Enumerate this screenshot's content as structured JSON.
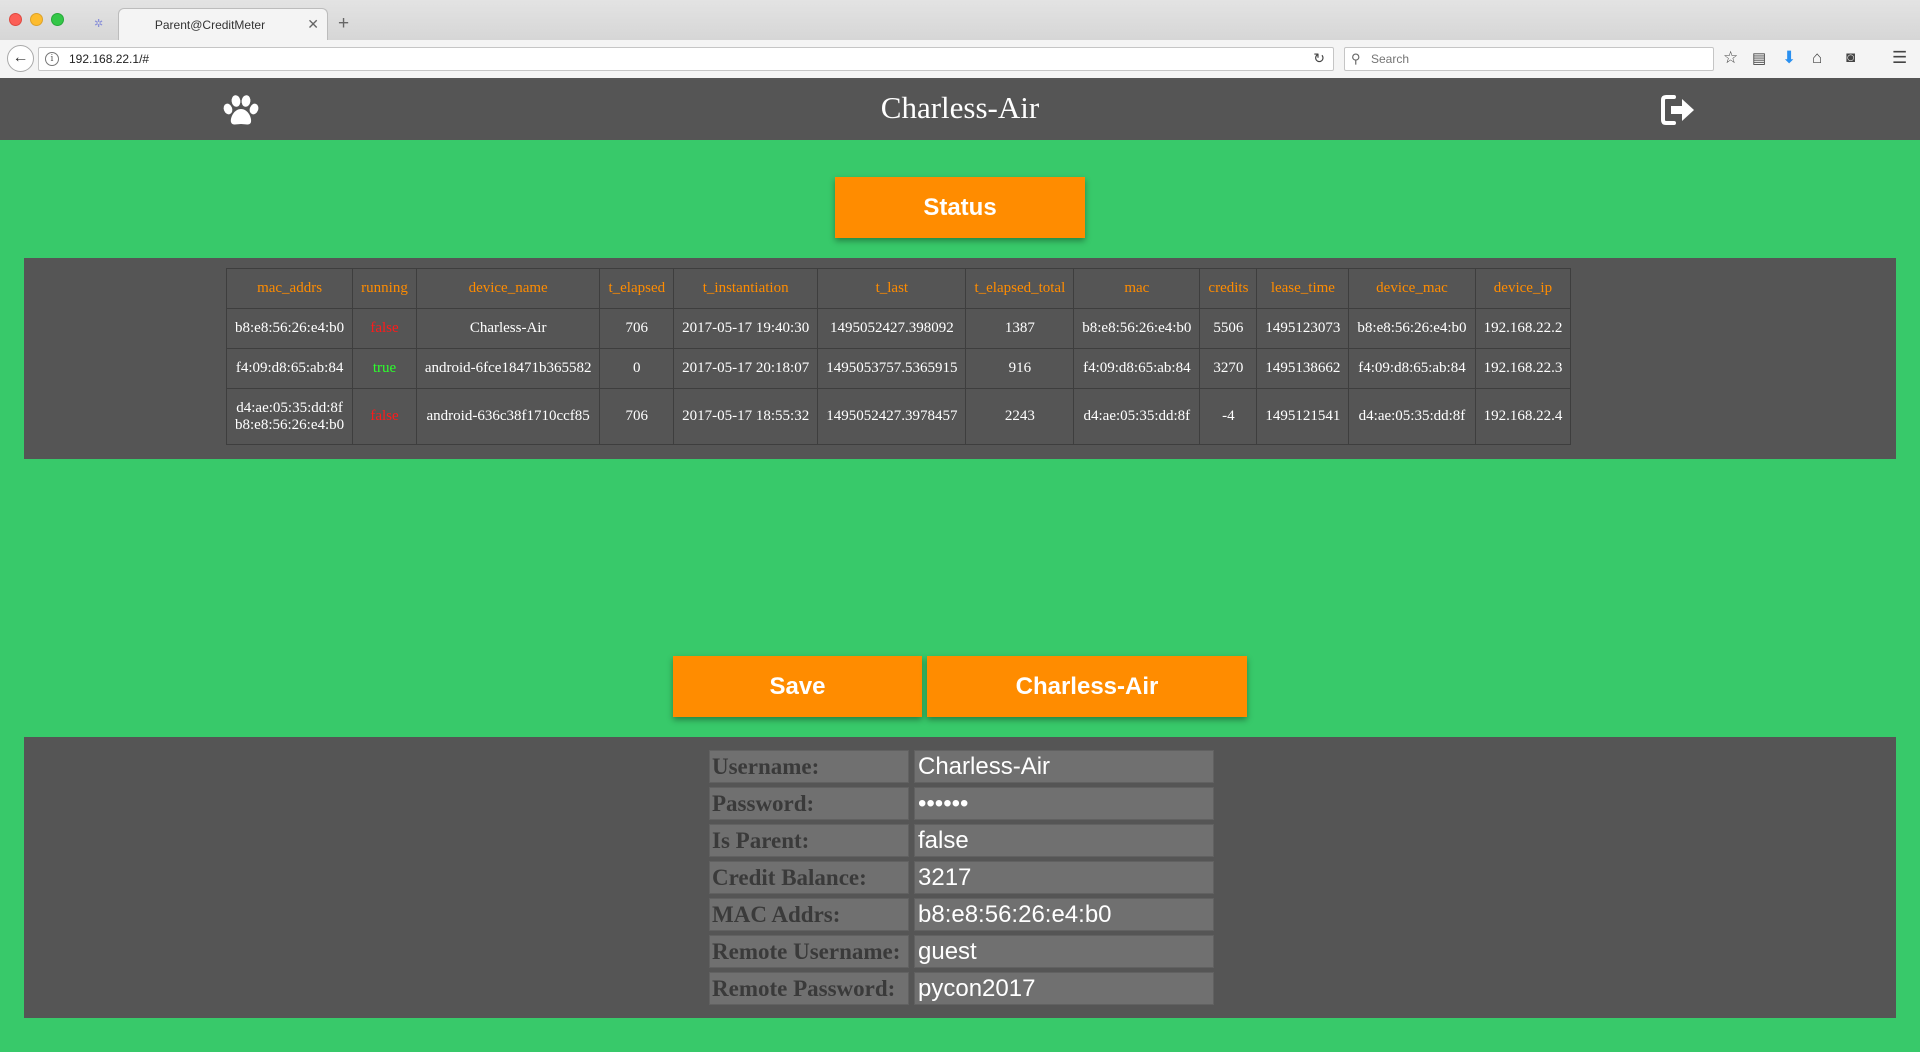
{
  "browser": {
    "tab_title": "Parent@CreditMeter",
    "url": "192.168.22.1/#",
    "search_placeholder": "Search"
  },
  "header": {
    "title": "Charless-Air"
  },
  "buttons": {
    "status": "Status",
    "save": "Save",
    "user": "Charless-Air"
  },
  "table": {
    "columns": [
      "mac_addrs",
      "running",
      "device_name",
      "t_elapsed",
      "t_instantiation",
      "t_last",
      "t_elapsed_total",
      "mac",
      "credits",
      "lease_time",
      "device_mac",
      "device_ip"
    ],
    "rows": [
      {
        "mac_addrs": [
          "b8:e8:56:26:e4:b0"
        ],
        "running": "false",
        "device_name": "Charless-Air",
        "t_elapsed": "706",
        "t_instantiation": "2017-05-17 19:40:30",
        "t_last": "1495052427.398092",
        "t_elapsed_total": "1387",
        "mac": "b8:e8:56:26:e4:b0",
        "credits": "5506",
        "lease_time": "1495123073",
        "device_mac": "b8:e8:56:26:e4:b0",
        "device_ip": "192.168.22.2"
      },
      {
        "mac_addrs": [
          "f4:09:d8:65:ab:84"
        ],
        "running": "true",
        "device_name": "android-6fce18471b365582",
        "t_elapsed": "0",
        "t_instantiation": "2017-05-17 20:18:07",
        "t_last": "1495053757.5365915",
        "t_elapsed_total": "916",
        "mac": "f4:09:d8:65:ab:84",
        "credits": "3270",
        "lease_time": "1495138662",
        "device_mac": "f4:09:d8:65:ab:84",
        "device_ip": "192.168.22.3"
      },
      {
        "mac_addrs": [
          "d4:ae:05:35:dd:8f",
          "b8:e8:56:26:e4:b0"
        ],
        "running": "false",
        "device_name": "android-636c38f1710ccf85",
        "t_elapsed": "706",
        "t_instantiation": "2017-05-17 18:55:32",
        "t_last": "1495052427.3978457",
        "t_elapsed_total": "2243",
        "mac": "d4:ae:05:35:dd:8f",
        "credits": "-4",
        "lease_time": "1495121541",
        "device_mac": "d4:ae:05:35:dd:8f",
        "device_ip": "192.168.22.4"
      }
    ]
  },
  "profile": {
    "fields": [
      {
        "label": "Username:",
        "value": "Charless-Air"
      },
      {
        "label": "Password:",
        "value": "••••••"
      },
      {
        "label": "Is Parent:",
        "value": "false"
      },
      {
        "label": "Credit Balance:",
        "value": "3217"
      },
      {
        "label": "MAC Addrs:",
        "value": "b8:e8:56:26:e4:b0"
      },
      {
        "label": "Remote Username:",
        "value": "guest"
      },
      {
        "label": "Remote Password:",
        "value": "pycon2017"
      }
    ]
  },
  "colors": {
    "background": "#38c96a",
    "panel": "#555555",
    "accent": "#ff8c00",
    "running_true": "#2cff2c",
    "running_false": "#ff1a1a"
  },
  "icons": {
    "header_left": "paw-icon",
    "header_right": "logout-icon"
  }
}
